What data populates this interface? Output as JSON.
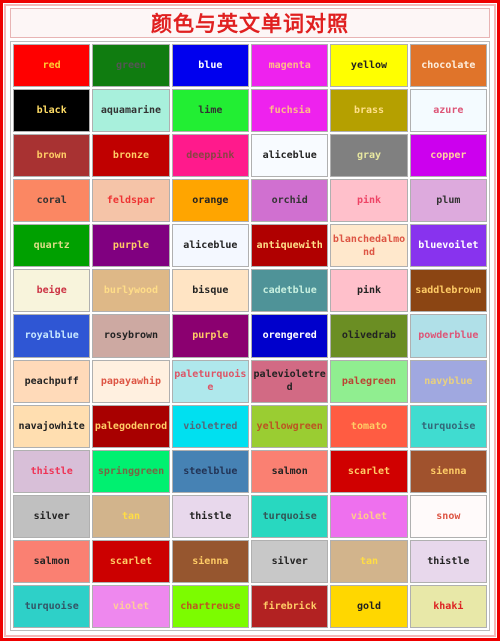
{
  "title": "颜色与英文单词对照",
  "theme": {
    "frame_border": "#ee0000",
    "frame_inner_border": "#f4b8b8",
    "title_color": "#e02020",
    "title_background": "#fdf6f6",
    "grid_border": "#bdbdbd",
    "cell_border": "#b0b0b0",
    "page_background": "#ffffff"
  },
  "table": {
    "columns": 6,
    "rows": 13,
    "cells": [
      {
        "label": "red",
        "bg": "#ff0000",
        "fg": "#ffcc33"
      },
      {
        "label": "green",
        "bg": "#107c10",
        "fg": "#555555"
      },
      {
        "label": "blue",
        "bg": "#0000ee",
        "fg": "#ffffff"
      },
      {
        "label": "magenta",
        "bg": "#ee22ee",
        "fg": "#ffbb88"
      },
      {
        "label": "yellow",
        "bg": "#ffff00",
        "fg": "#222222"
      },
      {
        "label": "chocolate",
        "bg": "#e0742a",
        "fg": "#fdf0e0"
      },
      {
        "label": "black",
        "bg": "#000000",
        "fg": "#ffdd66"
      },
      {
        "label": "aquamarine",
        "bg": "#a8f0dc",
        "fg": "#333333"
      },
      {
        "label": "lime",
        "bg": "#22ee33",
        "fg": "#333333"
      },
      {
        "label": "fuchsia",
        "bg": "#ee22ee",
        "fg": "#ffbb88"
      },
      {
        "label": "brass",
        "bg": "#b5a000",
        "fg": "#ffe08a"
      },
      {
        "label": "azure",
        "bg": "#f4fbff",
        "fg": "#dd5577"
      },
      {
        "label": "brown",
        "bg": "#a83232",
        "fg": "#ffcc66"
      },
      {
        "label": "bronze",
        "bg": "#c00000",
        "fg": "#ffcc66"
      },
      {
        "label": "deeppink",
        "bg": "#ff1a8c",
        "fg": "#884444"
      },
      {
        "label": "aliceblue",
        "bg": "#f8fbff",
        "fg": "#222222"
      },
      {
        "label": "gray",
        "bg": "#808080",
        "fg": "#e8e8a0"
      },
      {
        "label": "copper",
        "bg": "#cc00ee",
        "fg": "#ffd0a0"
      },
      {
        "label": "coral",
        "bg": "#fb8763",
        "fg": "#333333"
      },
      {
        "label": "feldspar",
        "bg": "#f5c4a8",
        "fg": "#ee3333"
      },
      {
        "label": "orange",
        "bg": "#ffa500",
        "fg": "#222222"
      },
      {
        "label": "orchid",
        "bg": "#d070d0",
        "fg": "#333333"
      },
      {
        "label": "pink",
        "bg": "#ffc0cb",
        "fg": "#ee4466"
      },
      {
        "label": "plum",
        "bg": "#ddaadd",
        "fg": "#333333"
      },
      {
        "label": "quartz",
        "bg": "#00a000",
        "fg": "#dddd88"
      },
      {
        "label": "purple",
        "bg": "#800080",
        "fg": "#ffcc66"
      },
      {
        "label": "aliceblue",
        "bg": "#f4f8ff",
        "fg": "#222222"
      },
      {
        "label": "antiquewith",
        "bg": "#b00000",
        "fg": "#ffe08a"
      },
      {
        "label": "blanchedalmond",
        "bg": "#ffe8cc",
        "fg": "#dd5544"
      },
      {
        "label": "bluevoilet",
        "bg": "#8833ee",
        "fg": "#ffffff"
      },
      {
        "label": "beige",
        "bg": "#f8f4dc",
        "fg": "#cc3344"
      },
      {
        "label": "burlywood",
        "bg": "#deb887",
        "fg": "#ffdd88"
      },
      {
        "label": "bisque",
        "bg": "#ffe4c4",
        "fg": "#222222"
      },
      {
        "label": "cadetblue",
        "bg": "#4f9398",
        "fg": "#c8f0e0"
      },
      {
        "label": "pink",
        "bg": "#ffc0cb",
        "fg": "#222222"
      },
      {
        "label": "saddlebrown",
        "bg": "#8b4513",
        "fg": "#ffcc66"
      },
      {
        "label": "royalblue",
        "bg": "#2f56d4",
        "fg": "#c8e8ff"
      },
      {
        "label": "rosybrown",
        "bg": "#cda9a2",
        "fg": "#222222"
      },
      {
        "label": "purple",
        "bg": "#8b0070",
        "fg": "#ffcc66"
      },
      {
        "label": "orengered",
        "bg": "#0000cc",
        "fg": "#ffffff"
      },
      {
        "label": "olivedrab",
        "bg": "#6b8e23",
        "fg": "#222222"
      },
      {
        "label": "powderblue",
        "bg": "#b0e0e8",
        "fg": "#dd5577"
      },
      {
        "label": "peachpuff",
        "bg": "#ffdab9",
        "fg": "#222222"
      },
      {
        "label": "papayawhip",
        "bg": "#fff0e0",
        "fg": "#dd5544"
      },
      {
        "label": "paleturquoise",
        "bg": "#afe8ec",
        "fg": "#dd5566"
      },
      {
        "label": "palevioletred",
        "bg": "#d26a84",
        "fg": "#222222"
      },
      {
        "label": "palegreen",
        "bg": "#90ee90",
        "fg": "#bb4433"
      },
      {
        "label": "navyblue",
        "bg": "#a0a8e0",
        "fg": "#e8d080"
      },
      {
        "label": "navajowhite",
        "bg": "#ffdeb0",
        "fg": "#222222"
      },
      {
        "label": "palegodenrod",
        "bg": "#a80000",
        "fg": "#ffcc66"
      },
      {
        "label": "violetred",
        "bg": "#00e0f0",
        "fg": "#556677"
      },
      {
        "label": "yellowgreen",
        "bg": "#9acd32",
        "fg": "#bb5522"
      },
      {
        "label": "tomato",
        "bg": "#ff5c42",
        "fg": "#ffcc66"
      },
      {
        "label": "turquoise",
        "bg": "#40dcd0",
        "fg": "#336677"
      },
      {
        "label": "thistle",
        "bg": "#d8bfd8",
        "fg": "#ee3355"
      },
      {
        "label": "springgreen",
        "bg": "#00f070",
        "fg": "#776644"
      },
      {
        "label": "steelblue",
        "bg": "#4682b4",
        "fg": "#223355"
      },
      {
        "label": "salmon",
        "bg": "#fa8072",
        "fg": "#222222"
      },
      {
        "label": "scarlet",
        "bg": "#d00000",
        "fg": "#ffcc66"
      },
      {
        "label": "sienna",
        "bg": "#a0522d",
        "fg": "#ffcc66"
      },
      {
        "label": "silver",
        "bg": "#c0c0c0",
        "fg": "#222222"
      },
      {
        "label": "tan",
        "bg": "#d2b48c",
        "fg": "#ffdd44"
      },
      {
        "label": "thistle",
        "bg": "#e8d8ec",
        "fg": "#222222"
      },
      {
        "label": "turquoise",
        "bg": "#28d8c0",
        "fg": "#335555"
      },
      {
        "label": "violet",
        "bg": "#ee70ee",
        "fg": "#ffcc88"
      },
      {
        "label": "snow",
        "bg": "#fffafa",
        "fg": "#dd5544"
      },
      {
        "label": "salmon",
        "bg": "#fa8072",
        "fg": "#222222"
      },
      {
        "label": "scarlet",
        "bg": "#cc0000",
        "fg": "#ffcc66"
      },
      {
        "label": "sienna",
        "bg": "#96562f",
        "fg": "#ffcc66"
      },
      {
        "label": "silver",
        "bg": "#c8c8c8",
        "fg": "#222222"
      },
      {
        "label": "tan",
        "bg": "#d2b48c",
        "fg": "#ffdd44"
      },
      {
        "label": "thistle",
        "bg": "#e8d8ec",
        "fg": "#222222"
      },
      {
        "label": "turquoise",
        "bg": "#2ed0c8",
        "fg": "#335566"
      },
      {
        "label": "violet",
        "bg": "#ee88ee",
        "fg": "#ffcc99"
      },
      {
        "label": "chartreuse",
        "bg": "#7cfc00",
        "fg": "#bb5522"
      },
      {
        "label": "firebrick",
        "bg": "#b22222",
        "fg": "#ffcc66"
      },
      {
        "label": "gold",
        "bg": "#ffd700",
        "fg": "#222222"
      },
      {
        "label": "khaki",
        "bg": "#e8e8a8",
        "fg": "#dd2222"
      }
    ]
  }
}
